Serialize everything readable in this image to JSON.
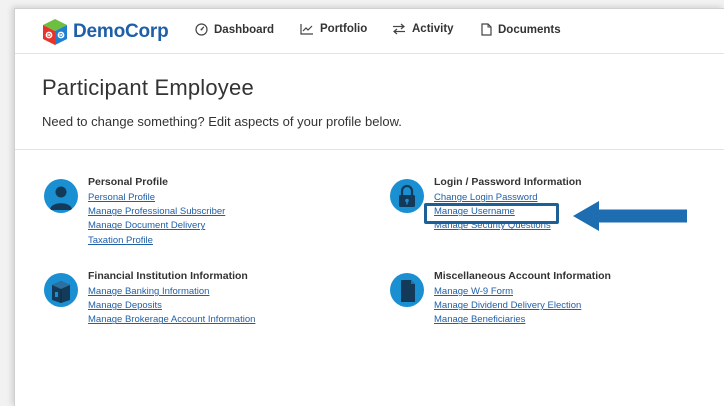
{
  "brand": {
    "name_part1": "Demo",
    "name_part2": "Corp"
  },
  "nav": [
    {
      "label": "Dashboard",
      "icon": "dashboard-icon"
    },
    {
      "label": "Portfolio",
      "icon": "chart-icon"
    },
    {
      "label": "Activity",
      "icon": "swap-arrows-icon"
    },
    {
      "label": "Documents",
      "icon": "document-icon"
    }
  ],
  "page": {
    "title": "Participant Employee",
    "subtitle": "Need to change something? Edit aspects of your profile below."
  },
  "sections": {
    "personal": {
      "title": "Personal Profile",
      "icon": "person-icon",
      "links": [
        "Personal Profile",
        "Manage Professional Subscriber",
        "Manage Document Delivery",
        "Taxation Profile"
      ]
    },
    "login": {
      "title": "Login / Password Information",
      "icon": "lock-icon",
      "links": [
        "Change Login Password",
        "Manage Username",
        "Manage Security Questions"
      ]
    },
    "financial": {
      "title": "Financial Institution Information",
      "icon": "bank-icon",
      "links": [
        "Manage Banking Information",
        "Manage Deposits",
        "Manage Brokerage Account Information"
      ]
    },
    "misc": {
      "title": "Miscellaneous Account Information",
      "icon": "file-icon",
      "links": [
        "Manage W-9 Form",
        "Manage Dividend Delivery Election",
        "Manage Beneficiaries"
      ]
    }
  },
  "colors": {
    "brand_blue": "#1f5fa8",
    "icon_blue": "#1a8fd1",
    "annotation_blue": "#1d5f96"
  }
}
